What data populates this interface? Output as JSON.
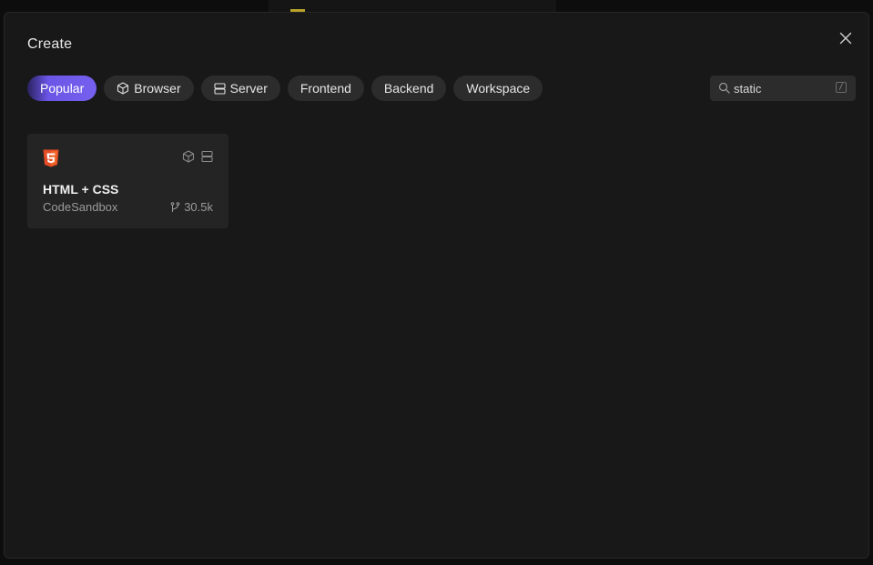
{
  "modal": {
    "title": "Create"
  },
  "filters": [
    {
      "label": "Popular",
      "icon": null,
      "active": true
    },
    {
      "label": "Browser",
      "icon": "cube-icon",
      "active": false
    },
    {
      "label": "Server",
      "icon": "server-icon",
      "active": false
    },
    {
      "label": "Frontend",
      "icon": null,
      "active": false
    },
    {
      "label": "Backend",
      "icon": null,
      "active": false
    },
    {
      "label": "Workspace",
      "icon": null,
      "active": false
    }
  ],
  "search": {
    "value": "static",
    "shortcut": "/"
  },
  "templates": [
    {
      "name": "HTML + CSS",
      "author": "CodeSandbox",
      "forks": "30.5k",
      "logo": "html5-icon",
      "environments": [
        "cube-icon",
        "server-icon"
      ]
    }
  ],
  "colors": {
    "accent": "#7660ee",
    "html5": "#e44d26",
    "modal_bg": "#181818",
    "card_bg": "#242424",
    "chip_bg": "#2c2c2c"
  }
}
